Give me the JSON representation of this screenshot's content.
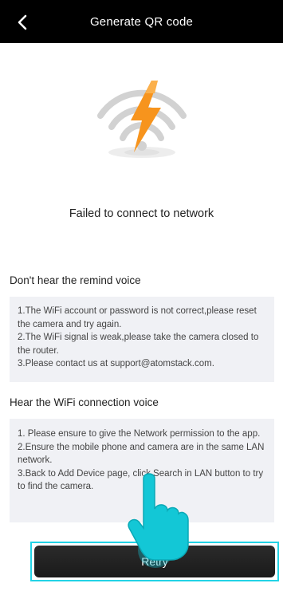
{
  "header": {
    "title": "Generate QR code",
    "back_icon": "chevron-left-icon"
  },
  "hero": {
    "icon": "wifi-failed-lightning-icon",
    "accent_color": "#f7941d",
    "wifi_color": "#cfcfcf"
  },
  "status": {
    "text": "Failed to connect to network"
  },
  "sections": [
    {
      "title": "Don't hear the remind voice",
      "body": "1.The WiFi account or password is not correct,please reset the camera and try again.\n2.The WiFi signal is weak,please take the camera closed to the router.\n3.Please contact us at support@atomstack.com."
    },
    {
      "title": "Hear the WiFi connection voice",
      "body": "1. Please ensure to give the Network permission to the app.\n2.Ensure the mobile phone and camera are in the same LAN network.\n3.Back to Add Device page, click Search in LAN button to try to find the camera."
    }
  ],
  "retry": {
    "label": "Retry",
    "highlight_color": "#22d3e6"
  },
  "pointer": {
    "icon": "tap-hand-pointer-icon",
    "color": "#13c7d6"
  }
}
